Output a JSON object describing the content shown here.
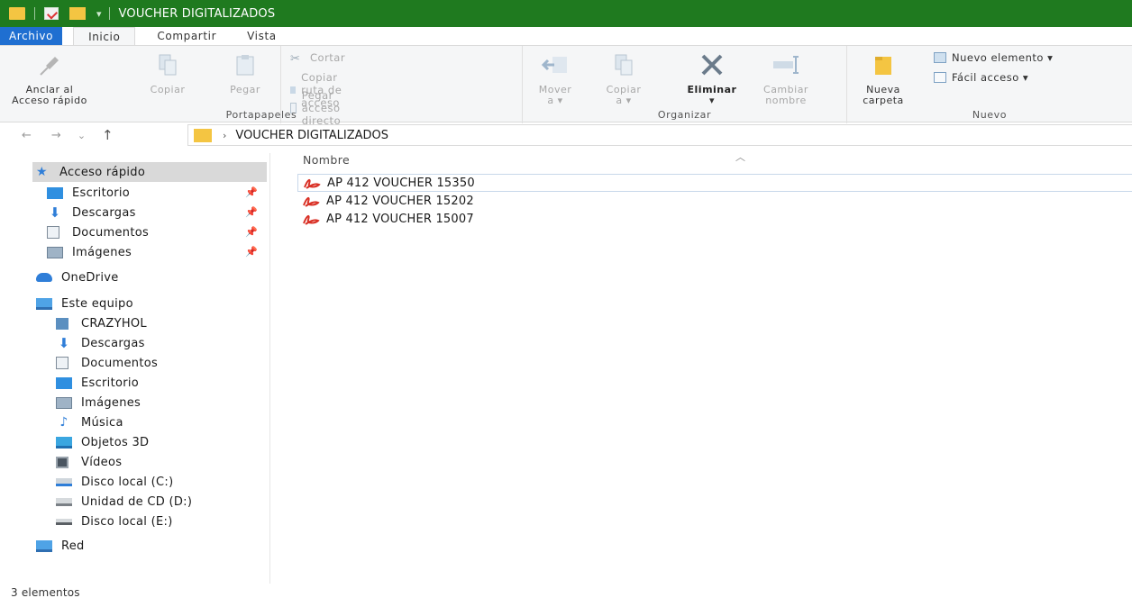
{
  "window": {
    "title": "VOUCHER DIGITALIZADOS"
  },
  "quick_access_toolbar": {
    "dropdown_glyph": "▾"
  },
  "ribbon_tabs": [
    {
      "label": "Archivo"
    },
    {
      "label": "Inicio"
    },
    {
      "label": "Compartir"
    },
    {
      "label": "Vista"
    }
  ],
  "ribbon": {
    "portapapeles": {
      "label": "Portapapeles",
      "anclar_line1": "Anclar al",
      "anclar_line2": "Acceso rápido",
      "copiar": "Copiar",
      "pegar": "Pegar",
      "cortar": "Cortar",
      "copiar_ruta": "Copiar ruta de acceso",
      "pegar_acceso": "Pegar acceso directo"
    },
    "organizar": {
      "label": "Organizar",
      "mover_line1": "Mover",
      "mover_line2": "a ▾",
      "copiar_line1": "Copiar",
      "copiar_line2": "a ▾",
      "eliminar": "Eliminar",
      "eliminar_dd": "▾",
      "cambiar_line1": "Cambiar",
      "cambiar_line2": "nombre"
    },
    "nuevo": {
      "label": "Nuevo",
      "nueva_line1": "Nueva",
      "nueva_line2": "carpeta",
      "nuevo_elemento": "Nuevo elemento ▾",
      "facil_acceso": "Fácil acceso ▾"
    }
  },
  "address_bar": {
    "back": "←",
    "forward": "→",
    "recent": "⌄",
    "up": "↑",
    "separator": "›",
    "path": "VOUCHER DIGITALIZADOS"
  },
  "nav_pane": {
    "quick_access": "Acceso rápido",
    "quick_items": [
      {
        "label": "Escritorio",
        "icon": "desktop-icon"
      },
      {
        "label": "Descargas",
        "icon": "downloads-icon"
      },
      {
        "label": "Documentos",
        "icon": "documents-icon"
      },
      {
        "label": "Imágenes",
        "icon": "pictures-icon"
      }
    ],
    "onedrive": "OneDrive",
    "este_equipo": "Este equipo",
    "pc_items": [
      {
        "label": "CRAZYHOL",
        "icon": "network-user-icon"
      },
      {
        "label": "Descargas",
        "icon": "downloads-icon"
      },
      {
        "label": "Documentos",
        "icon": "documents-icon"
      },
      {
        "label": "Escritorio",
        "icon": "desktop-icon"
      },
      {
        "label": "Imágenes",
        "icon": "pictures-icon"
      },
      {
        "label": "Música",
        "icon": "music-icon"
      },
      {
        "label": "Objetos 3D",
        "icon": "objects-3d-icon"
      },
      {
        "label": "Vídeos",
        "icon": "videos-icon"
      },
      {
        "label": "Disco local (C:)",
        "icon": "local-disk-icon"
      },
      {
        "label": "Unidad de CD (D:)",
        "icon": "cd-drive-icon"
      },
      {
        "label": "Disco local (E:)",
        "icon": "local-disk-icon"
      }
    ],
    "red": "Red"
  },
  "content": {
    "column_header": "Nombre",
    "sort_glyph": "︿",
    "files": [
      {
        "name": "AP 412 VOUCHER 15350",
        "icon": "pdf-icon"
      },
      {
        "name": "AP 412 VOUCHER 15202",
        "icon": "pdf-icon"
      },
      {
        "name": "AP 412 VOUCHER 15007",
        "icon": "pdf-icon"
      }
    ]
  },
  "status_bar": {
    "count": "3 elementos"
  },
  "colors": {
    "titlebar": "#1f7a1f",
    "file_tab": "#1f6fd1",
    "folder": "#f4c542",
    "pdf": "#d93025",
    "selected_nav": "#d9d9d9"
  }
}
